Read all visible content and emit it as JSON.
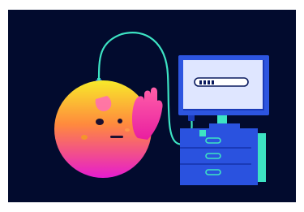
{
  "illustration": {
    "subject": "emoji-character-connected-to-computer",
    "colors": {
      "background": "#020b2e",
      "cable": "#3de3c3",
      "face_gradient_top": "#f7ea2a",
      "face_gradient_mid": "#ff8a3d",
      "face_gradient_bottom": "#e61ccf",
      "monitor_frame": "#2d55e0",
      "monitor_screen": "#dfe6ff",
      "monitor_screen_shadow": "#1a3ab8",
      "tower_body": "#2a52df",
      "tower_accent": "#3de3c3",
      "password_dots": "#0a1a5e"
    },
    "icons": [
      "emoji-face-icon",
      "hand-icon",
      "computer-monitor-icon",
      "password-field-icon",
      "computer-tower-icon",
      "cable-icon"
    ]
  }
}
